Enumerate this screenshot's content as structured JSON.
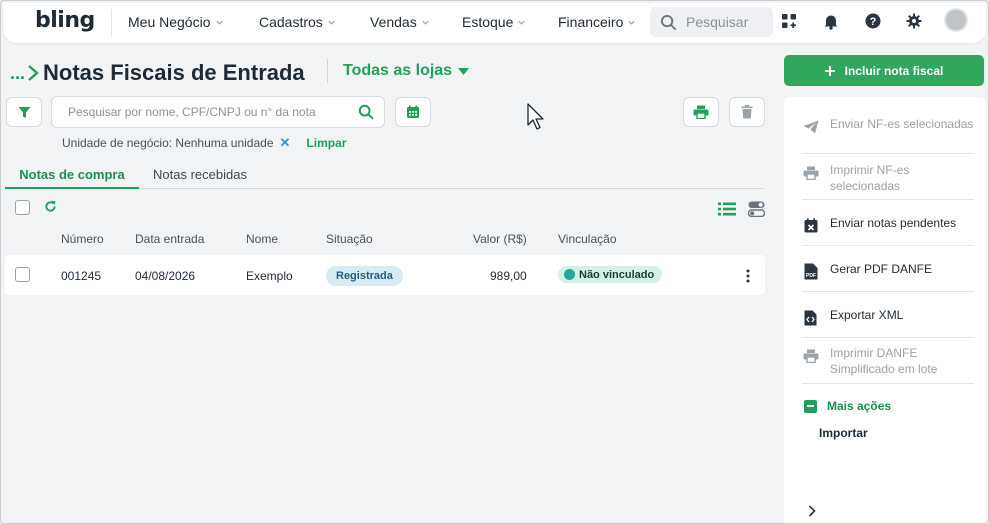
{
  "nav": {
    "logo": "bling",
    "items": [
      {
        "label": "Meu Negócio"
      },
      {
        "label": "Cadastros"
      },
      {
        "label": "Vendas"
      },
      {
        "label": "Estoque"
      },
      {
        "label": "Financeiro"
      }
    ],
    "search_placeholder": "Pesquisar",
    "icons": [
      "apps-icon",
      "bell-icon",
      "help-icon",
      "gear-icon",
      "avatar"
    ]
  },
  "header": {
    "breadcrumb_dots": "...",
    "title": "Notas Fiscais de Entrada",
    "store_select": "Todas as lojas"
  },
  "toolbar": {
    "search_placeholder": "Pesquisar por nome, CPF/CNPJ ou n° da nota"
  },
  "filter": {
    "label": "Unidade de negócio: Nenhuma unidade",
    "remove": "✕",
    "clear": "Limpar"
  },
  "tabs": [
    {
      "label": "Notas de compra",
      "active": true
    },
    {
      "label": "Notas recebidas",
      "active": false
    }
  ],
  "table": {
    "columns": [
      "Número",
      "Data entrada",
      "Nome",
      "Situação",
      "Valor (R$)",
      "Vinculação"
    ],
    "rows": [
      {
        "numero": "001245",
        "data": "04/08/2026",
        "nome": "Exemplo",
        "situacao": "Registrada",
        "valor": "989,00",
        "vinculacao": "Não vinculado"
      }
    ]
  },
  "side": {
    "include_button": "Incluir nota fiscal",
    "actions": [
      {
        "label": "Enviar NF-es selecionadas",
        "enabled": false,
        "icon": "send-icon"
      },
      {
        "label": "Imprimir NF-es selecionadas",
        "enabled": false,
        "icon": "printer-icon"
      },
      {
        "label": "Enviar notas pendentes",
        "enabled": true,
        "icon": "calendar-x-icon"
      },
      {
        "label": "Gerar PDF DANFE",
        "enabled": true,
        "icon": "pdf-file-icon"
      },
      {
        "label": "Exportar XML",
        "enabled": true,
        "icon": "code-file-icon"
      },
      {
        "label": "Imprimir DANFE Simplificado em lote",
        "enabled": false,
        "icon": "printer-icon"
      }
    ],
    "more_actions": "Mais ações",
    "import": "Importar"
  },
  "colors": {
    "brand_green": "#22a05b",
    "badge_registered_bg": "#d8ebf4",
    "badge_unlinked_bg": "#d3f1e6"
  }
}
